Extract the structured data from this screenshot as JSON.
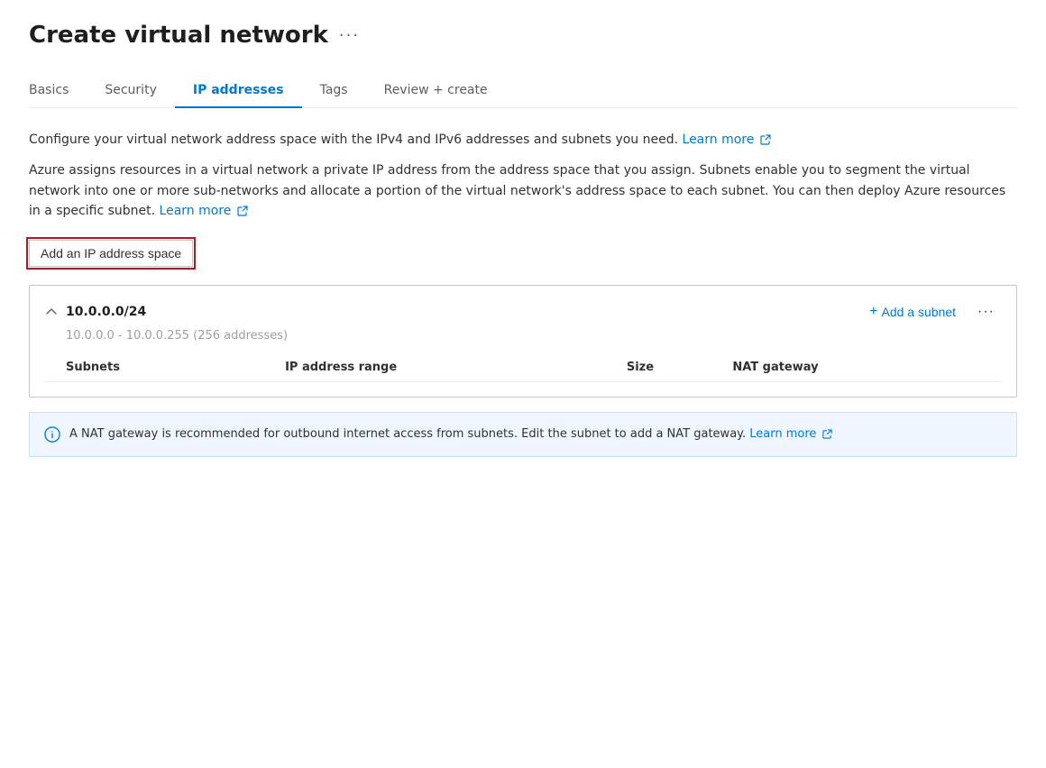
{
  "page": {
    "title": "Create virtual network",
    "more_label": "···"
  },
  "tabs": [
    {
      "id": "basics",
      "label": "Basics",
      "active": false
    },
    {
      "id": "security",
      "label": "Security",
      "active": false
    },
    {
      "id": "ip-addresses",
      "label": "IP addresses",
      "active": true
    },
    {
      "id": "tags",
      "label": "Tags",
      "active": false
    },
    {
      "id": "review-create",
      "label": "Review + create",
      "active": false
    }
  ],
  "description1": "Configure your virtual network address space with the IPv4 and IPv6 addresses and subnets you need.",
  "description1_learn_more": "Learn more",
  "description2": "Azure assigns resources in a virtual network a private IP address from the address space that you assign. Subnets enable you to segment the virtual network into one or more sub-networks and allocate a portion of the virtual network's address space to each subnet. You can then deploy Azure resources in a specific subnet.",
  "description2_learn_more": "Learn more",
  "add_ip_button": "Add an IP address space",
  "ip_space": {
    "cidr": "10.0.0.0/24",
    "range": "10.0.0.0 - 10.0.0.255 (256 addresses)",
    "add_subnet_label": "Add a subnet",
    "ellipsis": "···",
    "table_headers": [
      "Subnets",
      "IP address range",
      "Size",
      "NAT gateway"
    ]
  },
  "info_banner": {
    "text": "A NAT gateway is recommended for outbound internet access from subnets. Edit the subnet to add a NAT gateway.",
    "learn_more": "Learn more"
  }
}
